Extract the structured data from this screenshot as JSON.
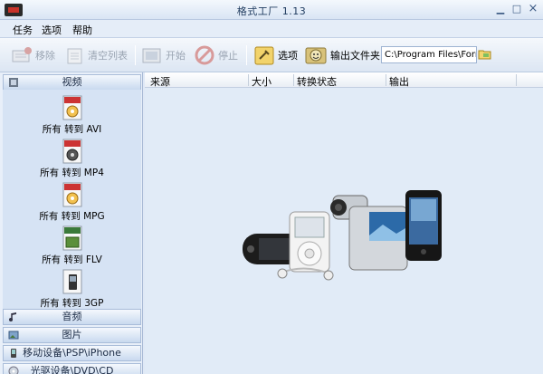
{
  "window": {
    "title": "格式工厂 1.13"
  },
  "window_controls": {
    "minimize": "▁",
    "maximize": "□",
    "close": "×"
  },
  "menu": {
    "items": [
      "任务",
      "选项",
      "帮助"
    ]
  },
  "toolbar": {
    "remove": "移除",
    "clear": "清空列表",
    "start": "开始",
    "stop": "停止",
    "options": "选项",
    "output_folder": "输出文件夹",
    "output_path": "C:\\Program Files\\Form"
  },
  "sidebar": {
    "video_header": "视频",
    "conversions": [
      {
        "label": "所有 转到 AVI",
        "badge": "AVI",
        "badge_color": "#cc3333"
      },
      {
        "label": "所有 转到 MP4",
        "badge": "MP4",
        "badge_color": "#cc3333"
      },
      {
        "label": "所有 转到 MPG",
        "badge": "MPG",
        "badge_color": "#cc3333"
      },
      {
        "label": "所有 转到 FLV",
        "badge": "FLV",
        "badge_color": "#3a7a3a"
      },
      {
        "label": "所有 转到 3GP",
        "badge": "3GP",
        "badge_color": "#555555"
      }
    ],
    "audio_header": "音频",
    "image_header": "图片",
    "mobile_header": "移动设备\\PSP\\iPhone",
    "disc_header": "光驱设备\\DVD\\CD"
  },
  "task_table": {
    "columns": [
      "来源",
      "大小",
      "转换状态",
      "输出"
    ]
  },
  "colors": {
    "accent": "#2f5f98",
    "panel": "#e1ebf7"
  }
}
